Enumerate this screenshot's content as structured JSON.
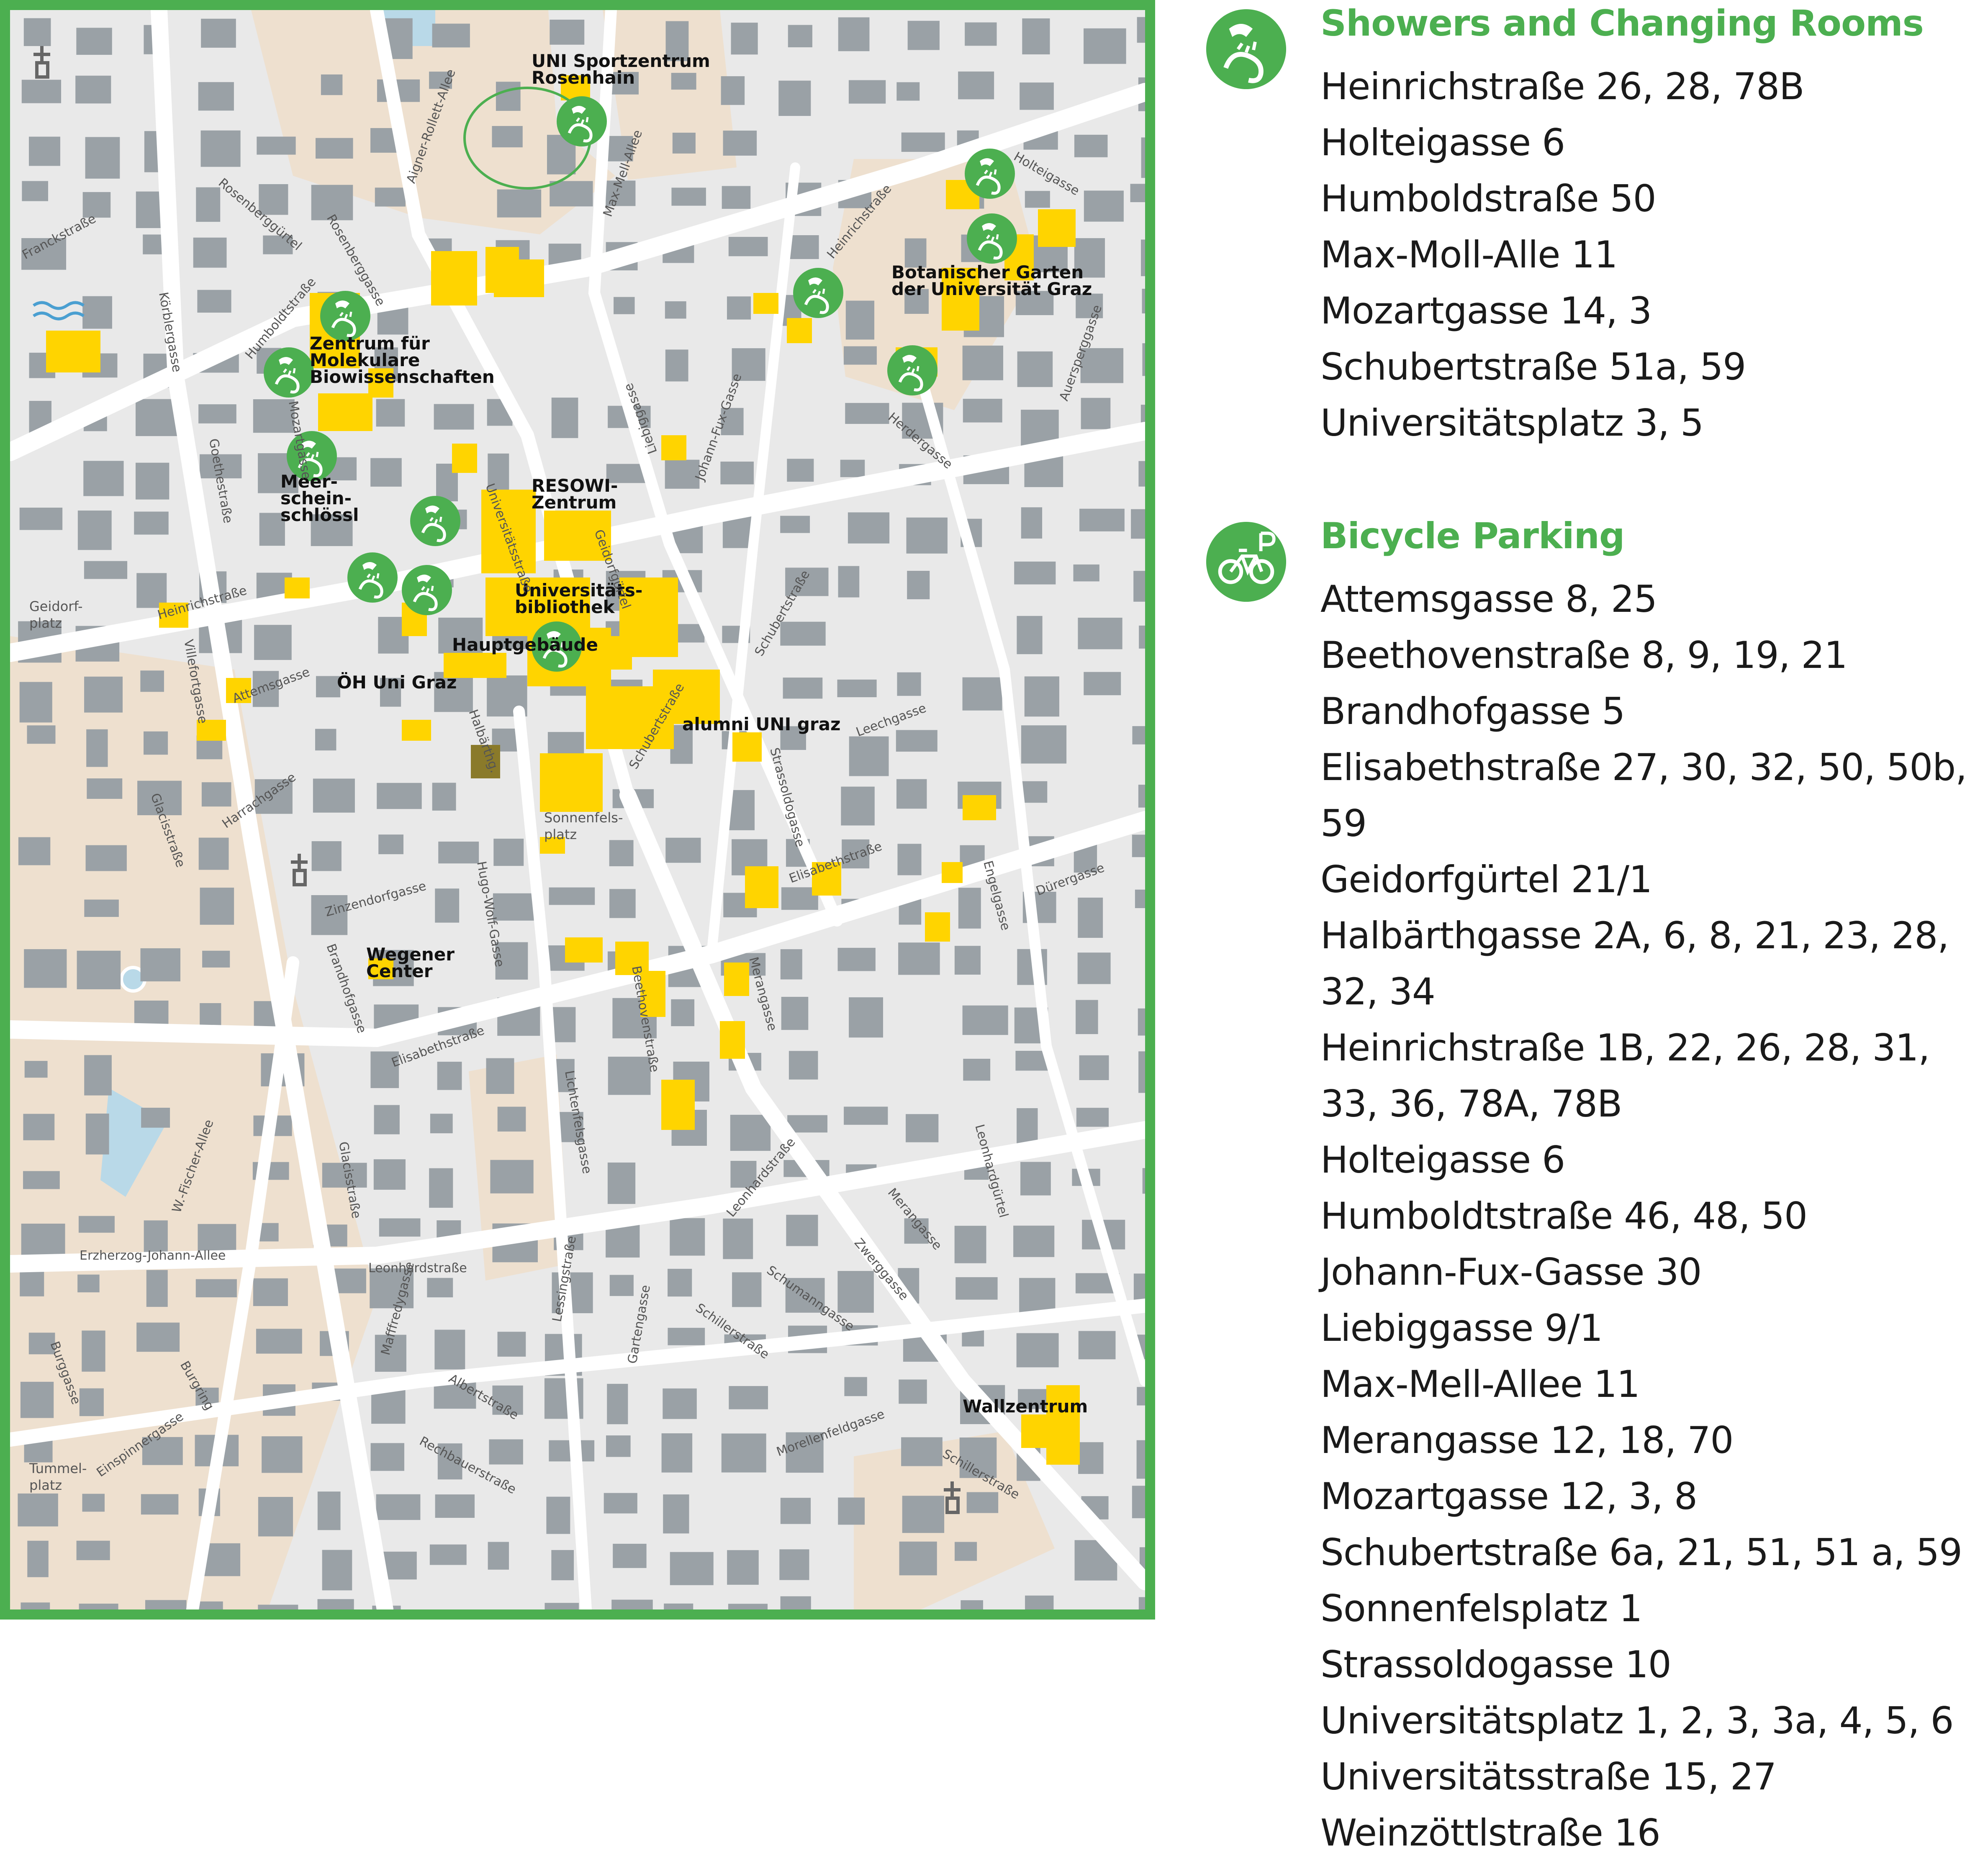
{
  "colors": {
    "frame": "#4caf50",
    "legend_title": "#4caf50",
    "building": "#9aa1a6",
    "university_building": "#ffd400",
    "park": "#eee0cf",
    "water": "#b9d9e8",
    "street": "#ffffff",
    "marker": "#4caf50"
  },
  "map": {
    "place_labels": [
      [
        "UNI Sportzentrum",
        "Rosenhain"
      ],
      [
        "Zentrum für",
        "Molekulare",
        "Biowissenschaften"
      ],
      [
        "Meer-",
        "schein-",
        "schlössl"
      ],
      [
        "RESOWI-",
        "Zentrum"
      ],
      [
        "Botanischer Garten",
        "der Universität Graz"
      ],
      [
        "Universitäts-",
        "bibliothek"
      ],
      [
        "Hauptgebäude"
      ],
      [
        "ÖH Uni Graz"
      ],
      [
        "alumni UNI graz"
      ],
      [
        "Wegener",
        "Center"
      ],
      [
        "Wallzentrum"
      ]
    ],
    "small_labels": [
      "Geidorf-",
      "platz",
      "Sonnenfels-",
      "platz",
      "Tummel-",
      "platz"
    ],
    "street_labels": [
      "Franckstraße",
      "Körblergasse",
      "Rosenberggürtel",
      "Rosenberggasse",
      "Aigner-Rollett-Allee",
      "Max-Mell-Allee",
      "Heinrichstraße",
      "Holteigasse",
      "Humboldtstraße",
      "Mozartgasse",
      "Goethestraße",
      "Universitätsstraße",
      "Liebiggasse",
      "Johann-Fux-Gasse",
      "Herdergasse",
      "Auersperggasse",
      "Heinrichstraße",
      "Geidorfgürtel",
      "Schubertstraße",
      "Villefortgasse",
      "Attemsgasse",
      "Halbärthg.",
      "Schubertstraße",
      "Leechgasse",
      "Harrachgasse",
      "Glacisstraße",
      "Zinzendorfgasse",
      "Hugo-Wolf-Gasse",
      "Strassoldogasse",
      "Elisabethstraße",
      "Dürergasse",
      "Engelgasse",
      "Brandhofgasse",
      "Merangasse",
      "Beethovenstraße",
      "Elisabethstraße",
      "Lichtenfelsgasse",
      "Leonhardstraße",
      "W.-Fischer-Allee",
      "Glacisstraße",
      "Erzherzog-Johann-Allee",
      "Leonhardstraße",
      "Merangasse",
      "Schumanngasse",
      "Zwerggasse",
      "Leonhardgürtel",
      "Burggasse",
      "Burgring",
      "Mafffredygasse",
      "Lessingstraße",
      "Albertstraße",
      "Gartengasse",
      "Schillerstraße",
      "Morellenfeldgasse",
      "Einspinnergasse",
      "Rechbauerstraße",
      "Schillerstraße"
    ]
  },
  "legend": {
    "showers": {
      "icon": "shower-icon",
      "title": "Showers and Changing Rooms",
      "items": [
        "Heinrichstraße 26, 28, 78B",
        "Holteigasse 6",
        "Humboldstraße 50",
        "Max-Moll-Alle 11",
        "Mozartgasse 14, 3",
        "Schubertstraße 51a, 59",
        "Universitätsplatz 3, 5"
      ]
    },
    "bikes": {
      "icon": "bicycle-parking-icon",
      "title": "Bicycle Parking",
      "items": [
        "Attemsgasse 8, 25",
        "Beethovenstraße 8, 9, 19, 21",
        "Brandhofgasse 5",
        "Elisabethstraße 27, 30, 32, 50, 50b,",
        "59",
        "Geidorfgürtel 21/1",
        "Halbärthgasse 2A, 6, 8, 21, 23, 28,",
        "32, 34",
        "Heinrichstraße 1B, 22, 26, 28, 31,",
        "33, 36, 78A, 78B",
        "Holteigasse 6",
        "Humboldtstraße 46, 48, 50",
        "Johann-Fux-Gasse 30",
        "Liebiggasse 9/1",
        "Max-Mell-Allee 11",
        "Merangasse 12, 18, 70",
        "Mozartgasse 12, 3, 8",
        "Schubertstraße 6a, 21, 51, 51 a, 59",
        "Sonnenfelsplatz 1",
        "Strassoldogasse 10",
        "Universitätsplatz 1, 2, 3, 3a, 4, 5, 6",
        "Universitätsstraße 15, 27",
        "Weinzöttlstraße 16"
      ]
    }
  }
}
